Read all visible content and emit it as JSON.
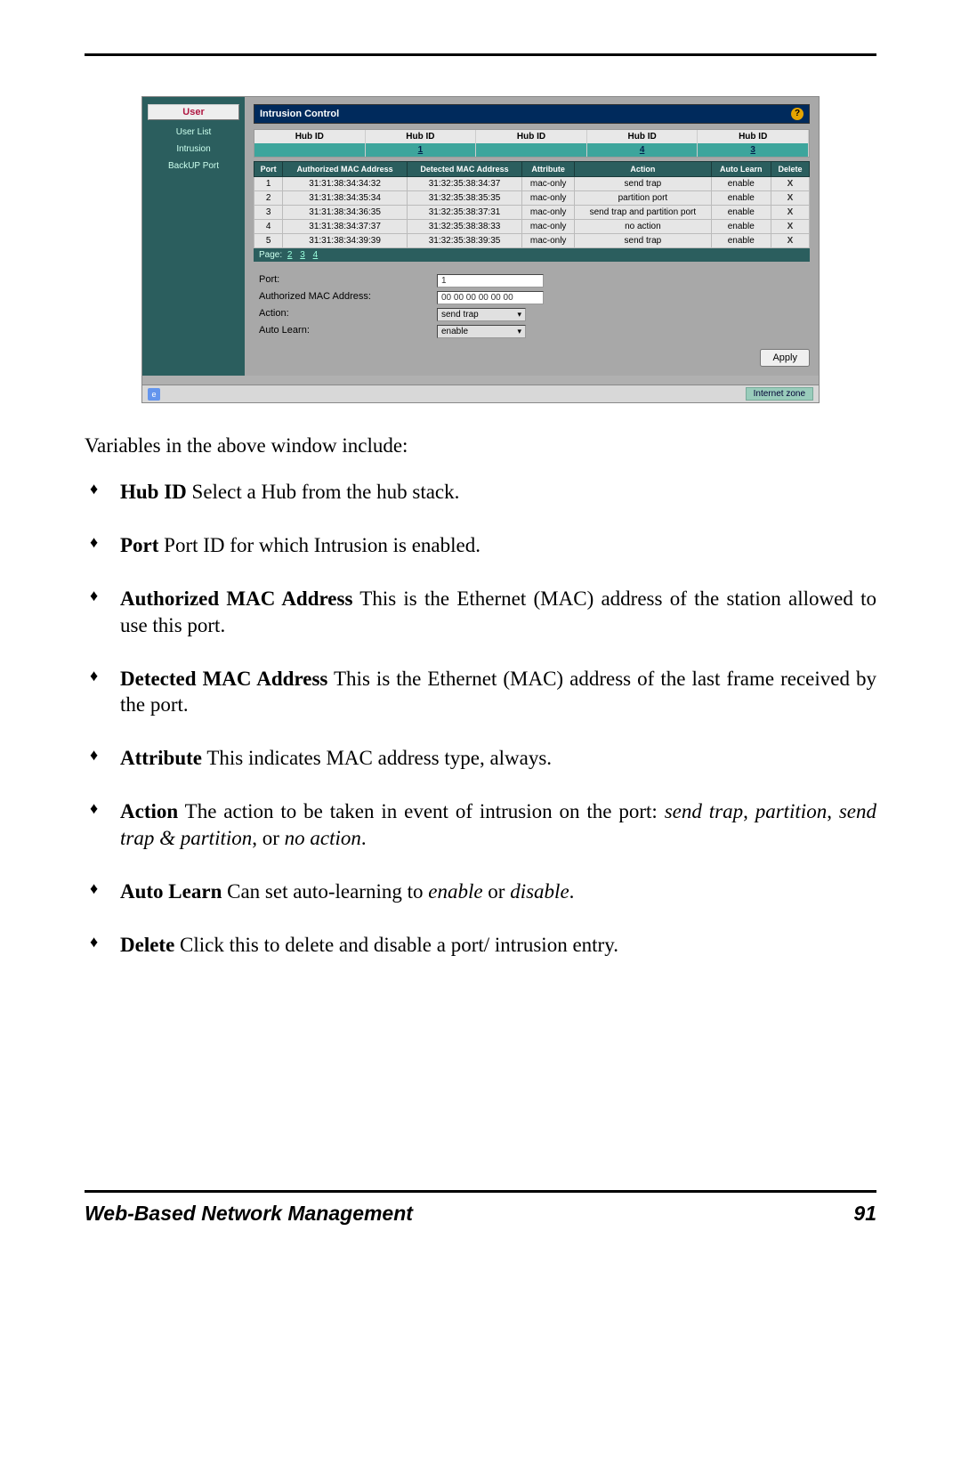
{
  "sidebar": {
    "activeTab": "User",
    "items": [
      "User List",
      "Intrusion",
      "BackUP Port"
    ]
  },
  "panel": {
    "title": "Intrusion Control",
    "helpBadge": "?",
    "hubs": {
      "label": "Hub ID",
      "values": [
        "",
        "1",
        "",
        "4",
        "3"
      ]
    },
    "columns": [
      "Port",
      "Authorized MAC Address",
      "Detected MAC Address",
      "Attribute",
      "Action",
      "Auto Learn",
      "Delete"
    ],
    "rows": [
      {
        "port": "1",
        "auth": "31:31:38:34:34:32",
        "det": "31:32:35:38:34:37",
        "attr": "mac-only",
        "action": "send trap",
        "auto": "enable",
        "del": "X"
      },
      {
        "port": "2",
        "auth": "31:31:38:34:35:34",
        "det": "31:32:35:38:35:35",
        "attr": "mac-only",
        "action": "partition port",
        "auto": "enable",
        "del": "X"
      },
      {
        "port": "3",
        "auth": "31:31:38:34:36:35",
        "det": "31:32:35:38:37:31",
        "attr": "mac-only",
        "action": "send trap and partition port",
        "auto": "enable",
        "del": "X"
      },
      {
        "port": "4",
        "auth": "31:31:38:34:37:37",
        "det": "31:32:35:38:38:33",
        "attr": "mac-only",
        "action": "no action",
        "auto": "enable",
        "del": "X"
      },
      {
        "port": "5",
        "auth": "31:31:38:34:39:39",
        "det": "31:32:35:38:39:35",
        "attr": "mac-only",
        "action": "send trap",
        "auto": "enable",
        "del": "X"
      }
    ],
    "pager": {
      "label": "Page:",
      "pages": [
        "2",
        "3",
        "4"
      ]
    },
    "form": {
      "portLabel": "Port:",
      "portValue": "1",
      "authLabel": "Authorized MAC Address:",
      "authValue": "00 00 00 00 00 00",
      "actionLabel": "Action:",
      "actionValue": "send trap",
      "autoLabel": "Auto Learn:",
      "autoValue": "enable",
      "applyLabel": "Apply"
    },
    "status": {
      "zone": "Internet zone",
      "iconText": "e"
    }
  },
  "doc": {
    "intro": "Variables in the above window include:",
    "items": [
      {
        "term": "Hub ID",
        "preSpace": "    ",
        "body": "Select a Hub from the hub stack."
      },
      {
        "term": "Port",
        "preSpace": "    ",
        "body": "Port ID for which Intrusion is enabled."
      },
      {
        "term": "Authorized MAC Address",
        "preSpace": "    ",
        "body": "This is the Ethernet (MAC) address of the station allowed to use this port."
      },
      {
        "term": "Detected MAC Address",
        "preSpace": "    ",
        "body": "This is the Ethernet (MAC) address of the last frame received by the port."
      },
      {
        "term": "Attribute",
        "preSpace": "    ",
        "body": "This indicates MAC address type, always."
      },
      {
        "term": "Action",
        "preSpace": "    ",
        "body_prefix": "The action to be taken in event of intrusion on the port:  ",
        "italics": [
          "send trap",
          ", ",
          "partition",
          ", ",
          "send trap & partition",
          ", or ",
          "no action",
          "."
        ]
      },
      {
        "term": "Auto Learn",
        "preSpace": "    ",
        "body_prefix": "Can set auto-learning to ",
        "italics": [
          "enable",
          " or ",
          "disable",
          "."
        ]
      },
      {
        "term": "Delete",
        "preSpace": "    ",
        "body": "Click this to delete and disable a port/ intrusion entry."
      }
    ],
    "footerLeft": "Web-Based Network Management",
    "footerRight": "91"
  }
}
